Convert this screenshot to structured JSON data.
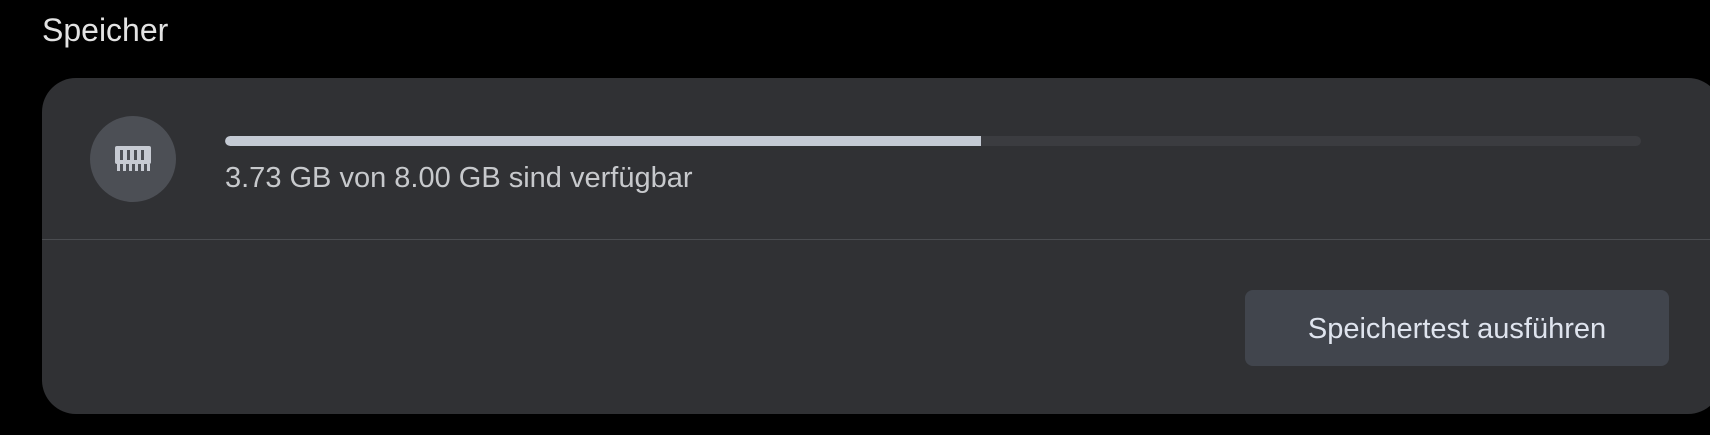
{
  "section": {
    "title": "Speicher"
  },
  "memory": {
    "icon": "memory-chip-icon",
    "available_gb": 3.73,
    "total_gb": 8.0,
    "used_fraction": 0.534,
    "status_text": "3.73 GB von 8.00 GB sind verfügbar"
  },
  "actions": {
    "run_test_label": "Speichertest ausführen"
  },
  "colors": {
    "background": "#000000",
    "card": "#303134",
    "icon_circle": "#4c4f55",
    "progress_fill": "#c4cad4",
    "progress_track": "#3b3c40",
    "button": "#41454d"
  }
}
